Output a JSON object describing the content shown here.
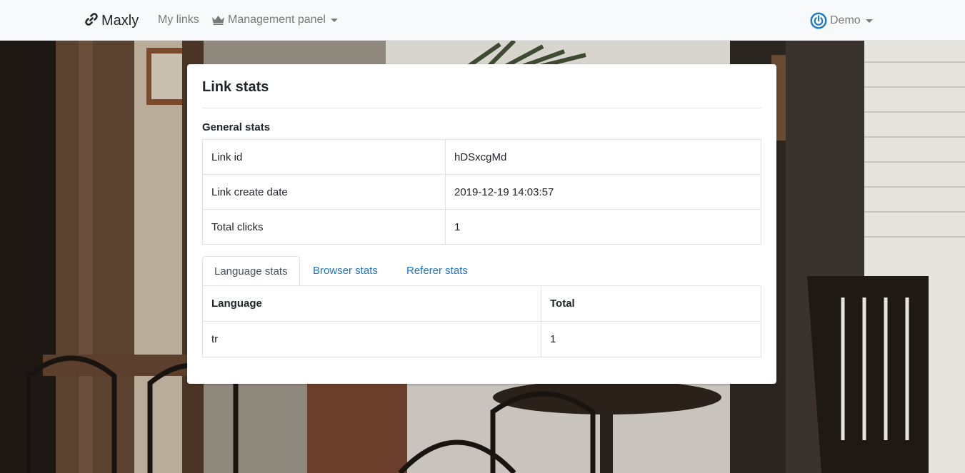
{
  "navbar": {
    "brand_icon": "link-icon",
    "brand": "Maxly",
    "my_links": "My links",
    "management_icon": "crown-icon",
    "management_panel": "Management panel",
    "user_icon": "power-icon",
    "user": "Demo"
  },
  "card": {
    "title": "Link stats",
    "general_title": "General stats",
    "general_rows": [
      {
        "label": "Link id",
        "value": "hDSxcgMd"
      },
      {
        "label": "Link create date",
        "value": "2019-12-19 14:03:57"
      },
      {
        "label": "Total clicks",
        "value": "1"
      }
    ],
    "tabs": [
      {
        "label": "Language stats",
        "active": true
      },
      {
        "label": "Browser stats",
        "active": false
      },
      {
        "label": "Referer stats",
        "active": false
      }
    ],
    "language_table": {
      "headers": [
        "Language",
        "Total"
      ],
      "rows": [
        [
          "tr",
          "1"
        ]
      ]
    }
  },
  "colors": {
    "navbar_bg": "#f8f9fa",
    "link": "#1a73c8",
    "power_icon": "#1b7ac2"
  }
}
